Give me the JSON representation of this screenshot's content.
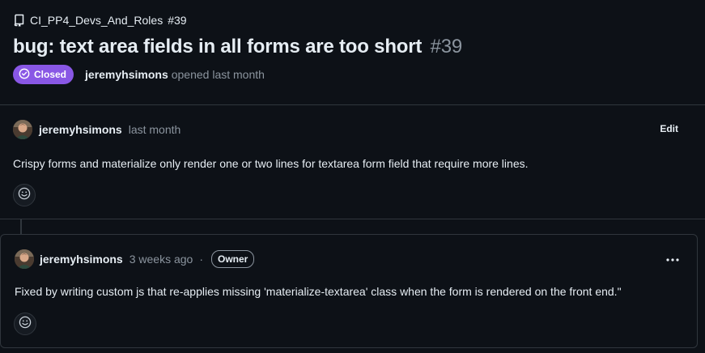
{
  "repo": {
    "name": "CI_PP4_Devs_And_Roles",
    "issue_ref": "#39",
    "icon": "repo-icon"
  },
  "issue": {
    "title": "bug: text area fields in all forms are too short",
    "number": "#39",
    "state": "Closed",
    "state_color": "#8957e5",
    "author": "jeremyhsimons",
    "opened_text": "opened last month"
  },
  "comments": [
    {
      "author": "jeremyhsimons",
      "timestamp": "last month",
      "action_label": "Edit",
      "body": "Crispy forms and materialize only render one or two lines for textarea form field that require more lines.",
      "reaction_icon": "smiley-icon"
    },
    {
      "author": "jeremyhsimons",
      "timestamp": "3 weeks ago",
      "separator": "·",
      "role_badge": "Owner",
      "menu_icon": "kebab-menu-icon",
      "body": "Fixed by writing custom js that re-applies missing 'materialize-textarea' class when the form is rendered on the front end.\"",
      "reaction_icon": "smiley-icon"
    }
  ],
  "colors": {
    "background": "#0d1117",
    "border": "#30363d",
    "text": "#e6edf3",
    "muted": "#8b949e",
    "closed_purple": "#8957e5"
  }
}
